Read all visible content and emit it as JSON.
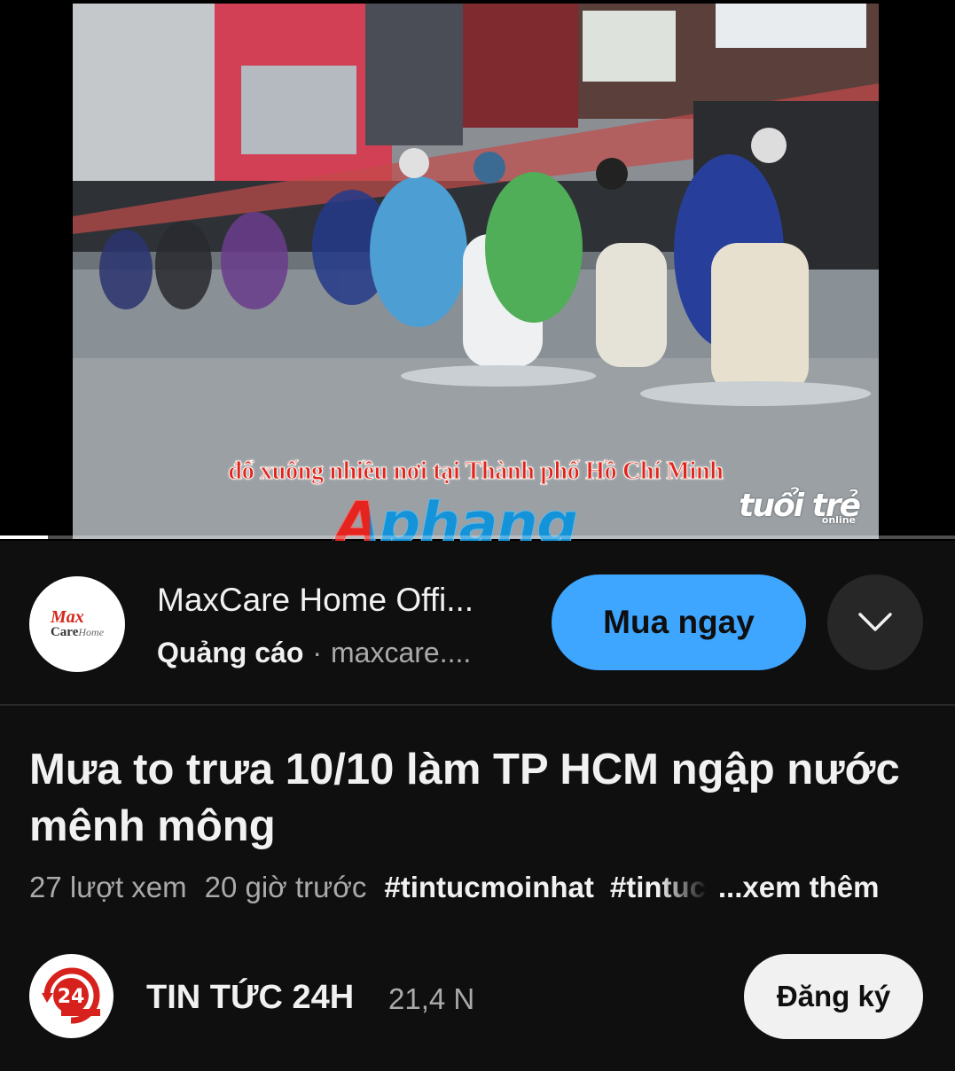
{
  "video": {
    "caption": "đổ xuống nhiều nơi tại Thành phố Hồ Chí Minh",
    "source_logo": "tuổi trẻ",
    "source_logo_sub": "online",
    "watermark": "Aphang",
    "progress": 0.05
  },
  "ad": {
    "logo_icon": "maxcare-logo-icon",
    "logo_brand_top": "Max",
    "logo_brand_bottom": "Care",
    "logo_brand_suffix": "Home",
    "title": "MaxCare Home Offi...",
    "tag": "Quảng cáo",
    "separator": "·",
    "domain": "maxcare....",
    "cta_label": "Mua ngay",
    "expand_icon": "chevron-down-icon"
  },
  "title": "Mưa to trưa 10/10 làm TP HCM ngập nước mênh mông",
  "meta": {
    "views": "27 lượt xem",
    "time": "20 giờ trước",
    "hashtag_1": "#tintucmoinhat",
    "hashtag_2": "#tintuc",
    "more": "...xem thêm"
  },
  "channel": {
    "avatar_icon": "24h-channel-logo-icon",
    "name": "TIN TỨC 24H",
    "subscribers": "21,4 N",
    "subscribe_label": "Đăng ký"
  },
  "colors": {
    "background": "#0f0f0f",
    "cta": "#3ea6ff",
    "secondary_text": "#aaaaaa",
    "caption_red": "#e0241c"
  }
}
